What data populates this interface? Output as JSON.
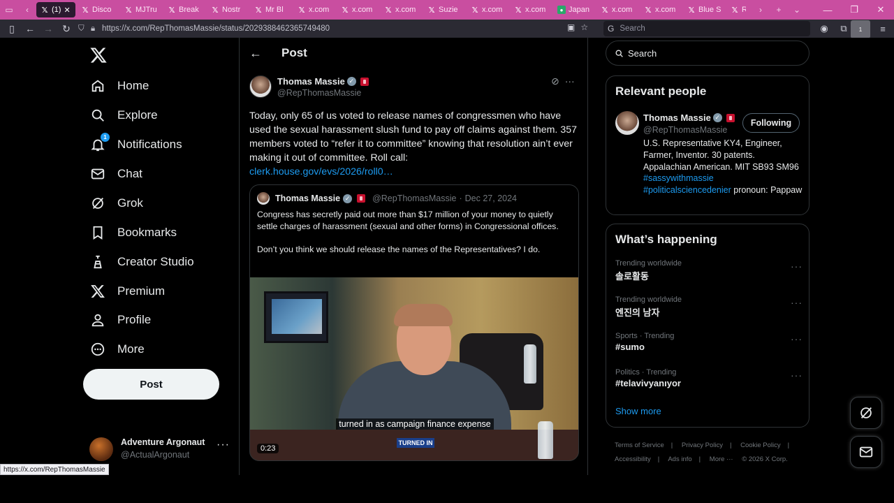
{
  "browser": {
    "tabs": [
      {
        "label": "(1)",
        "icon": "x",
        "active": true
      },
      {
        "label": "Disco",
        "icon": "x"
      },
      {
        "label": "MJTru",
        "icon": "x"
      },
      {
        "label": "Break",
        "icon": "x"
      },
      {
        "label": "Nostr",
        "icon": "x"
      },
      {
        "label": "Mr Bl",
        "icon": "x"
      },
      {
        "label": "x.com",
        "icon": "x"
      },
      {
        "label": "x.com",
        "icon": "x"
      },
      {
        "label": "x.com",
        "icon": "x"
      },
      {
        "label": "Suzie",
        "icon": "x"
      },
      {
        "label": "x.com",
        "icon": "x"
      },
      {
        "label": "x.com",
        "icon": "x"
      },
      {
        "label": "Japan",
        "icon": "green"
      },
      {
        "label": "x.com",
        "icon": "x"
      },
      {
        "label": "x.com",
        "icon": "x"
      },
      {
        "label": "Blue S",
        "icon": "x"
      },
      {
        "label": "R",
        "icon": "x"
      }
    ],
    "url": "https://x.com/RepThomasMassie/status/2029388462365749480",
    "search_placeholder": "Search",
    "ublock_count": "1",
    "status_url": "https://x.com/RepThomasMassie"
  },
  "sidebar": {
    "items": [
      {
        "label": "Home"
      },
      {
        "label": "Explore"
      },
      {
        "label": "Notifications",
        "badge": "1"
      },
      {
        "label": "Chat"
      },
      {
        "label": "Grok"
      },
      {
        "label": "Bookmarks"
      },
      {
        "label": "Creator Studio"
      },
      {
        "label": "Premium"
      },
      {
        "label": "Profile"
      },
      {
        "label": "More"
      }
    ],
    "post_button": "Post",
    "account": {
      "name": "Adventure Argonaut",
      "handle": "@ActualArgonaut"
    }
  },
  "main": {
    "header_title": "Post",
    "tweet": {
      "name": "Thomas Massie",
      "handle": "@RepThomasMassie",
      "text": "Today, only 65 of us voted to release names of congressmen who have used the sexual harassment slush fund to pay off claims against them. 357 members voted to “refer it to committee” knowing that resolution ain’t ever making it out of committee. Roll call:",
      "link": "clerk.house.gov/evs/2026/roll0…"
    },
    "quote": {
      "name": "Thomas Massie",
      "handle": "@RepThomasMassie",
      "date": "Dec 27, 2024",
      "para1": "Congress has secretly paid out more than $17 million of your money to quietly settle charges of harassment (sexual and other forms) in  Congressional offices.",
      "para2": "Don’t you think we should release the names of the Representatives? I do.",
      "video_caption": "turned in as campaign finance expense",
      "video_nameplate": "TURNED IN",
      "video_time": "0:23"
    }
  },
  "right": {
    "search_placeholder": "Search",
    "relevant": {
      "title": "Relevant people",
      "name": "Thomas Massie",
      "handle": "@RepThomasMassie",
      "follow_label": "Following",
      "bio_text": "U.S. Representative KY4, Engineer, Farmer, Inventor. 30 patents. Appalachian American. MIT SB93 SM96",
      "bio_tag1": "#sassywithmassie",
      "bio_tag2": "#politicalsciencedenier",
      "bio_tail": "pronoun: Pappaw"
    },
    "happening": {
      "title": "What’s happening",
      "trends": [
        {
          "context": "Trending worldwide",
          "topic": "솔로활동"
        },
        {
          "context": "Trending worldwide",
          "topic": "엔진의 남자"
        },
        {
          "context": "Sports · Trending",
          "topic": "#sumo"
        },
        {
          "context": "Politics · Trending",
          "topic": "#telavivyanıyor"
        }
      ],
      "show_more": "Show more"
    },
    "footer": [
      "Terms of Service",
      "|",
      "Privacy Policy",
      "|",
      "Cookie Policy",
      "|",
      "Accessibility",
      "|",
      "Ads info",
      "|",
      "More ···",
      "© 2026 X Corp."
    ]
  }
}
